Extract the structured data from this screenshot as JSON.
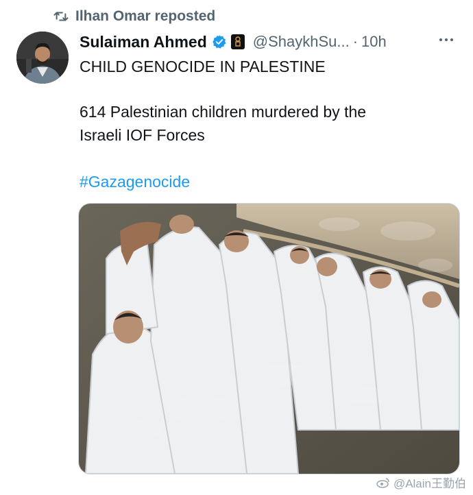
{
  "repost": {
    "icon": "repost-icon",
    "label": "Ilhan Omar reposted"
  },
  "author": {
    "name": "Sulaiman Ahmed",
    "handle": "@ShaykhSu...",
    "time": "10h",
    "separator": "·",
    "verified_icon": "verified-badge-icon",
    "affiliation_icon": "affiliation-badge-icon"
  },
  "tweet": {
    "line1": "CHILD GENOCIDE IN PALESTINE",
    "line2": "614 Palestinian children murdered by the",
    "line3": "Israeli IOF Forces",
    "hashtag": "#Gazagenocide"
  },
  "media": {
    "description_icon": "photo"
  },
  "watermark": {
    "text": "@Alain王勤伯"
  },
  "colors": {
    "text": "#0f1419",
    "secondary": "#536471",
    "link": "#1d9bf0",
    "verified": "#1d9bf0"
  }
}
